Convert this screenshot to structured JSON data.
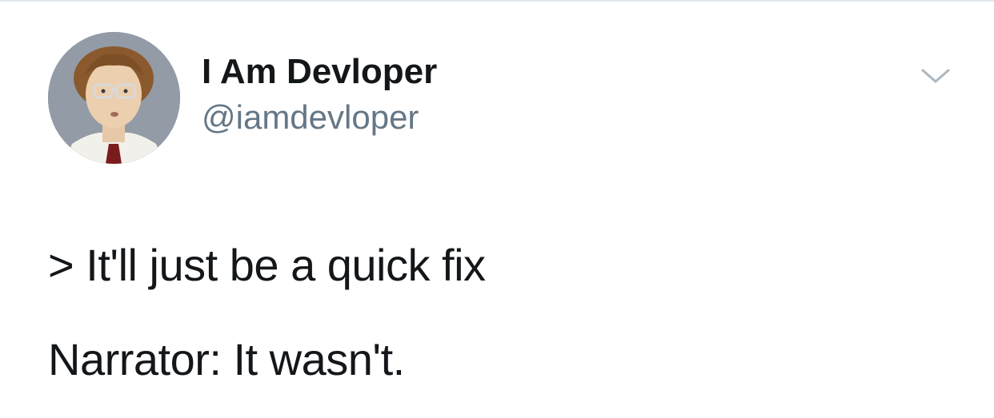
{
  "tweet": {
    "author": {
      "display_name": "I Am Devloper",
      "handle": "@iamdevloper"
    },
    "text_lines": [
      "> It'll just be a quick fix",
      "Narrator: It wasn't."
    ],
    "menu_icon": "chevron-down-icon"
  },
  "colors": {
    "name": "#14171a",
    "handle": "#657786",
    "chevron": "#aab8c2",
    "divider": "#e1e8ed"
  }
}
